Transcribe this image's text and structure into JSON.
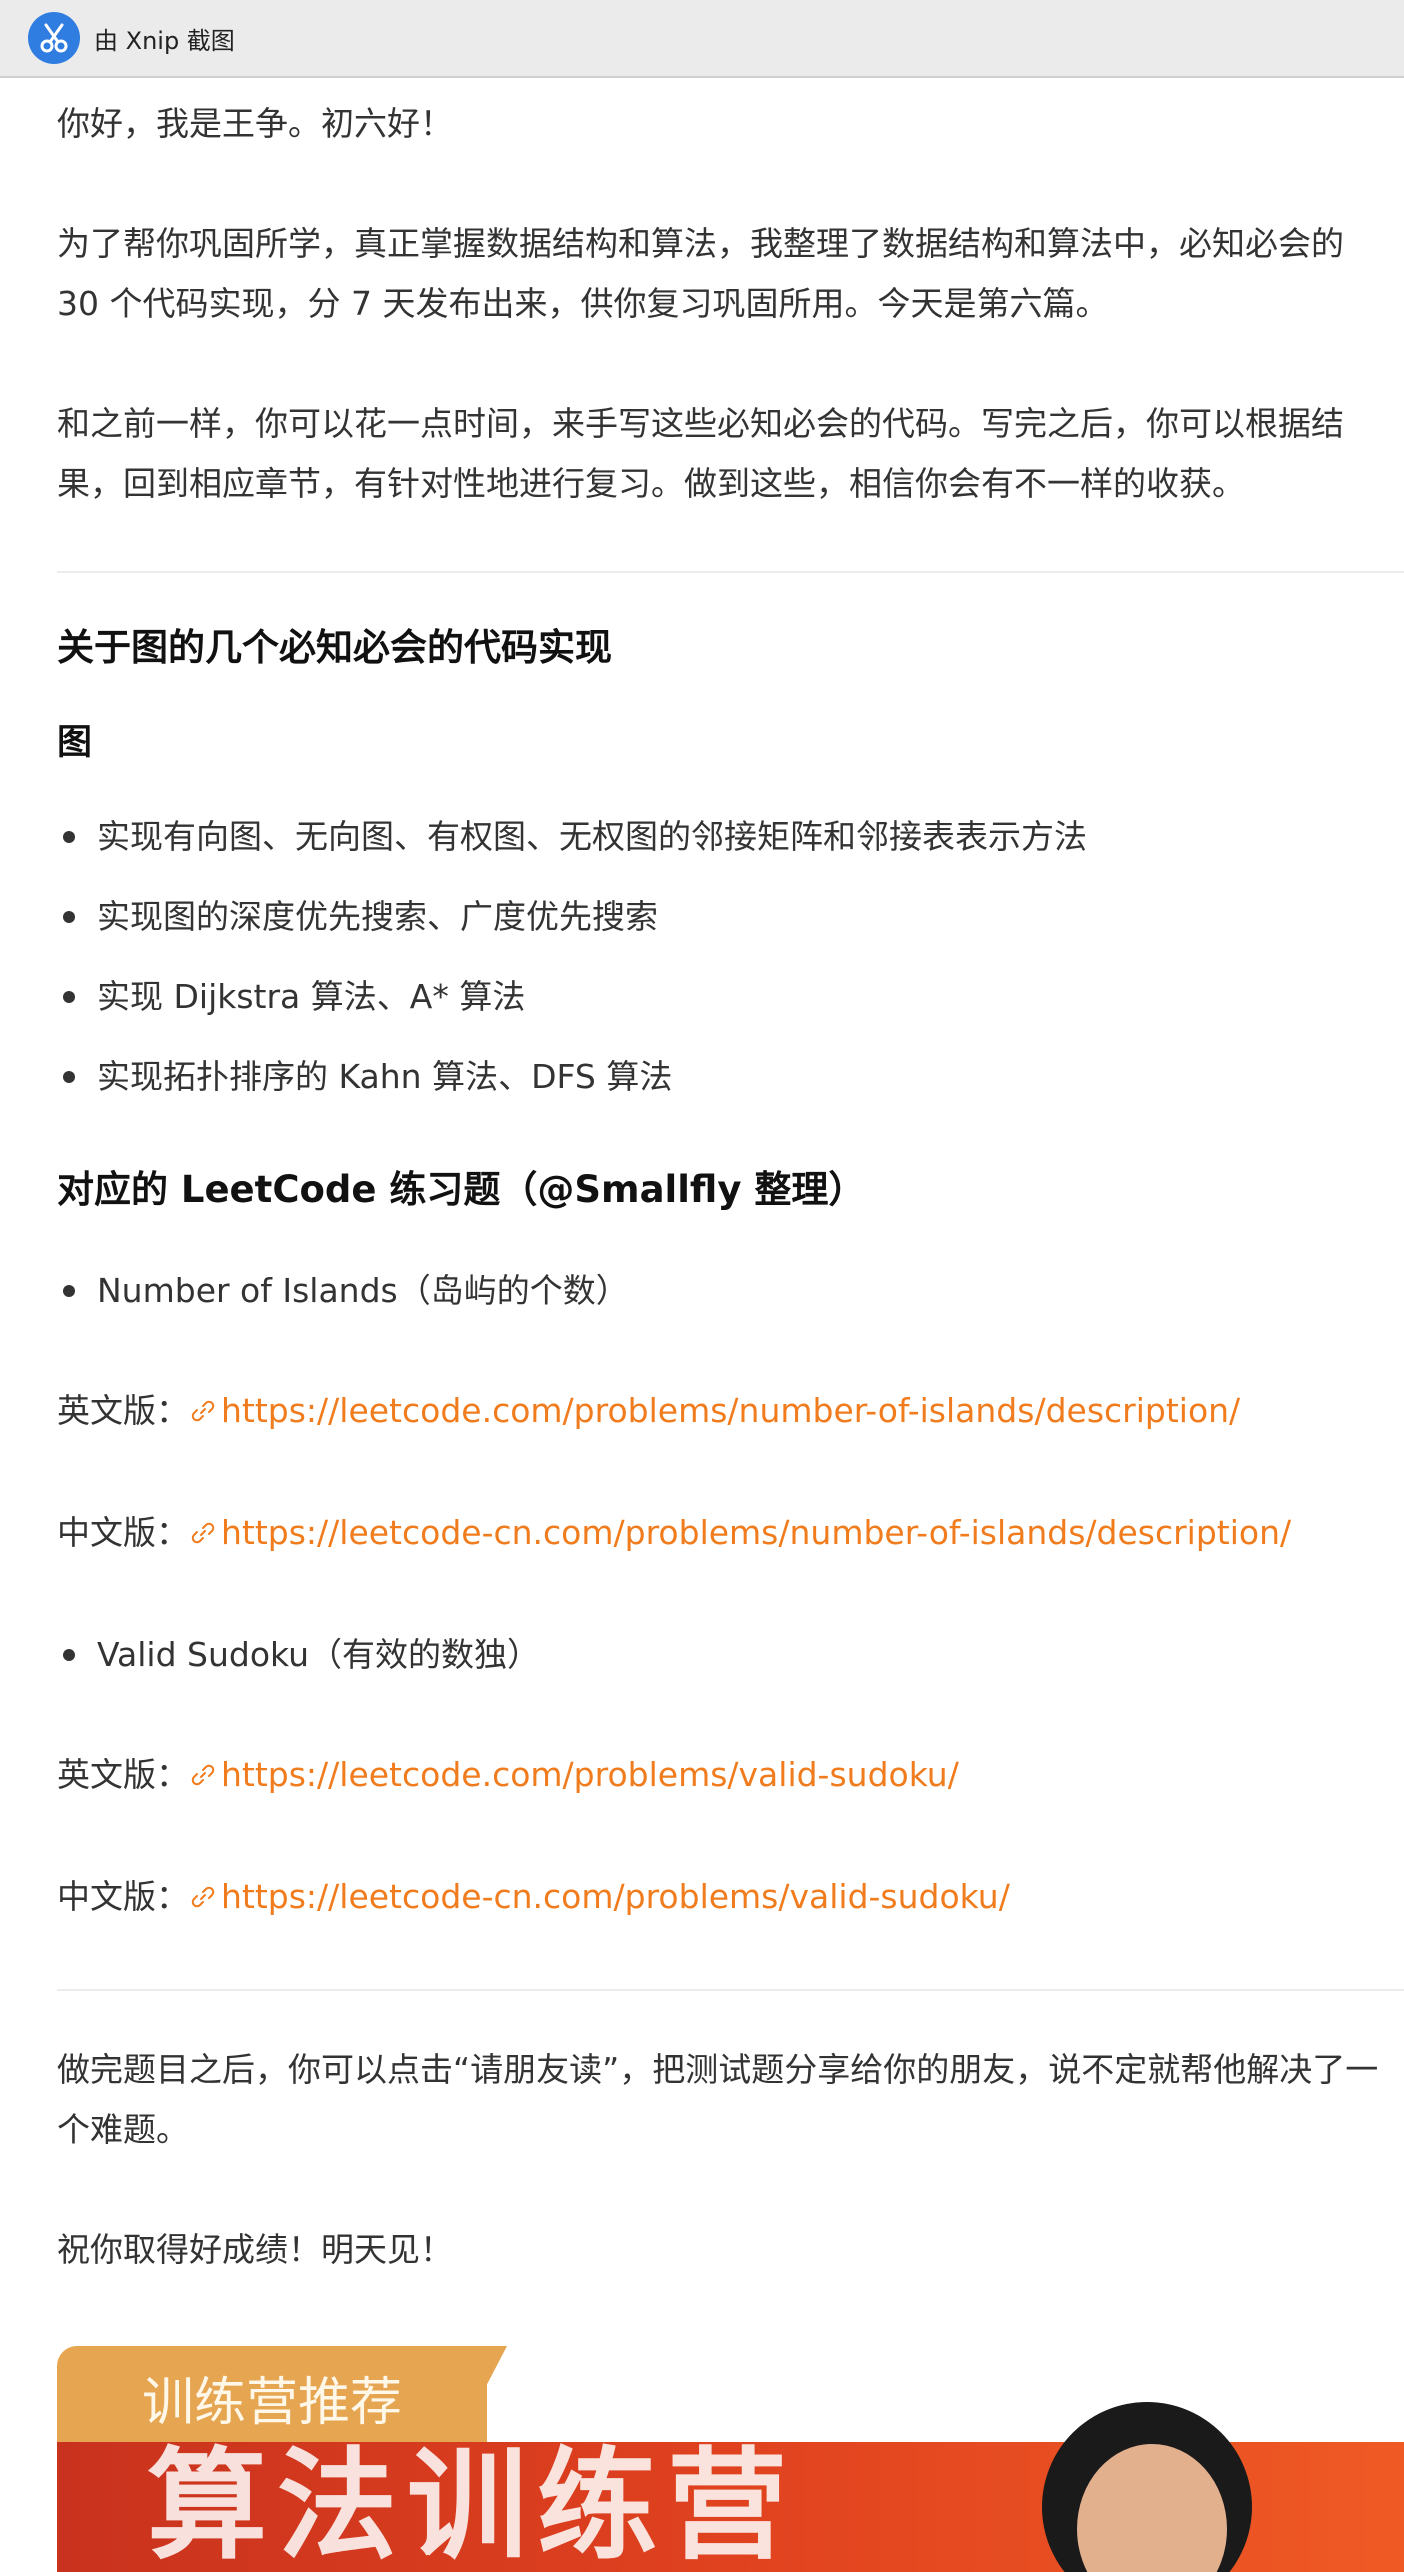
{
  "window": {
    "title": "由 Xnip 截图",
    "app_icon": "xnip-scissors-icon",
    "accent": "#2f7de1"
  },
  "article": {
    "intro": [
      "你好，我是王争。初六好！",
      "为了帮你巩固所学，真正掌握数据结构和算法，我整理了数据结构和算法中，必知必会的 30 个代码实现，分 7 天发布出来，供你复习巩固所用。今天是第六篇。",
      "和之前一样，你可以花一点时间，来手写这些必知必会的代码。写完之后，你可以根据结果，回到相应章节，有针对性地进行复习。做到这些，相信你会有不一样的收获。"
    ],
    "section_title": "关于图的几个必知必会的代码实现",
    "subsection_title": "图",
    "graph_items": [
      "实现有向图、无向图、有权图、无权图的邻接矩阵和邻接表表示方法",
      "实现图的深度优先搜索、广度优先搜索",
      "实现 Dijkstra 算法、A* 算法",
      "实现拓扑排序的 Kahn 算法、DFS 算法"
    ],
    "leetcode_title": "对应的 LeetCode 练习题（@Smallfly 整理）",
    "problems": [
      {
        "name": "Number of Islands（岛屿的个数）",
        "en_label": "英文版：",
        "en_url": "https://leetcode.com/problems/number-of-islands/description/",
        "cn_label": "中文版：",
        "cn_url": "https://leetcode-cn.com/problems/number-of-islands/description/"
      },
      {
        "name": "Valid Sudoku（有效的数独）",
        "en_label": "英文版：",
        "en_url": "https://leetcode.com/problems/valid-sudoku/",
        "cn_label": "中文版：",
        "cn_url": "https://leetcode-cn.com/problems/valid-sudoku/"
      }
    ],
    "outro": [
      "做完题目之后，你可以点击“请朋友读”，把测试题分享给你的朋友，说不定就帮他解决了一个难题。",
      "祝你取得好成绩！明天见！"
    ],
    "link_color": "#f07c1e"
  },
  "promo": {
    "tab_label": "训练营推荐",
    "banner_text": "算法训练营",
    "tab_color": "#e6a551",
    "banner_color": "#e0421f"
  }
}
